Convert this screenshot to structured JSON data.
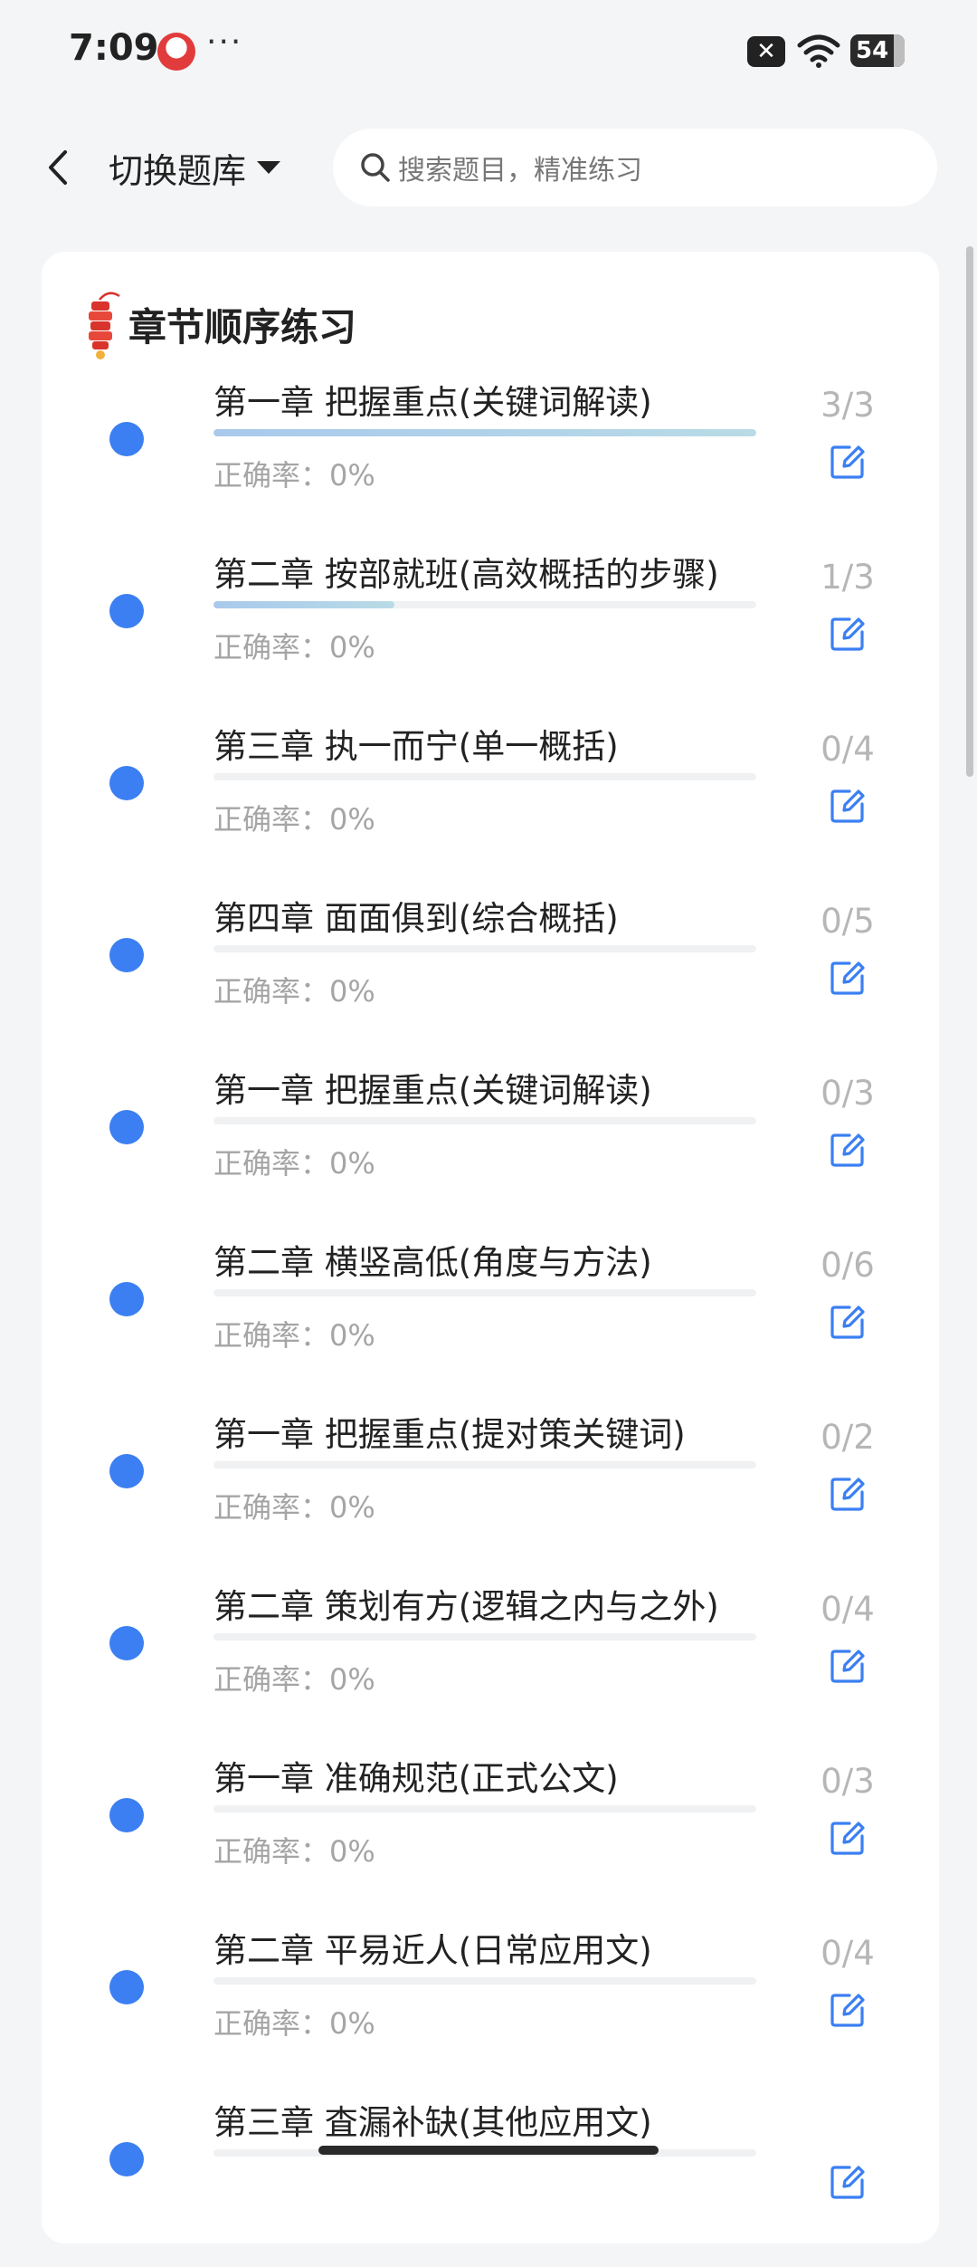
{
  "status_bar": {
    "time": "7:09",
    "more": "···",
    "battery": "54",
    "icons": [
      "app-icon",
      "close-badge-icon",
      "wifi-icon",
      "battery-icon"
    ]
  },
  "header": {
    "switch_label": "切换题库",
    "search_placeholder": "搜索题目，精准练习"
  },
  "section": {
    "title": "章节顺序练习"
  },
  "chapters": [
    {
      "title": "第一章 把握重点(关键词解读)",
      "accuracy": "正确率：0%",
      "count": "3/3",
      "progress": 1.0
    },
    {
      "title": "第二章 按部就班(高效概括的步骤)",
      "accuracy": "正确率：0%",
      "count": "1/3",
      "progress": 0.333
    },
    {
      "title": "第三章 执一而宁(单一概括)",
      "accuracy": "正确率：0%",
      "count": "0/4",
      "progress": 0
    },
    {
      "title": "第四章 面面俱到(综合概括)",
      "accuracy": "正确率：0%",
      "count": "0/5",
      "progress": 0
    },
    {
      "title": "第一章 把握重点(关键词解读)",
      "accuracy": "正确率：0%",
      "count": "0/3",
      "progress": 0
    },
    {
      "title": "第二章 横竖高低(角度与方法)",
      "accuracy": "正确率：0%",
      "count": "0/6",
      "progress": 0
    },
    {
      "title": "第一章 把握重点(提对策关键词)",
      "accuracy": "正确率：0%",
      "count": "0/2",
      "progress": 0
    },
    {
      "title": "第二章 策划有方(逻辑之内与之外)",
      "accuracy": "正确率：0%",
      "count": "0/4",
      "progress": 0
    },
    {
      "title": "第一章 准确规范(正式公文)",
      "accuracy": "正确率：0%",
      "count": "0/3",
      "progress": 0
    },
    {
      "title": "第二章 平易近人(日常应用文)",
      "accuracy": "正确率：0%",
      "count": "0/4",
      "progress": 0
    },
    {
      "title": "第三章 査漏补缺(其他应用文)",
      "accuracy": "",
      "count": "",
      "progress": 0
    }
  ],
  "colors": {
    "accent_dot": "#3b7ff2",
    "edit_icon": "#3b7ff2",
    "progress_fill": "#a9c9ec"
  }
}
